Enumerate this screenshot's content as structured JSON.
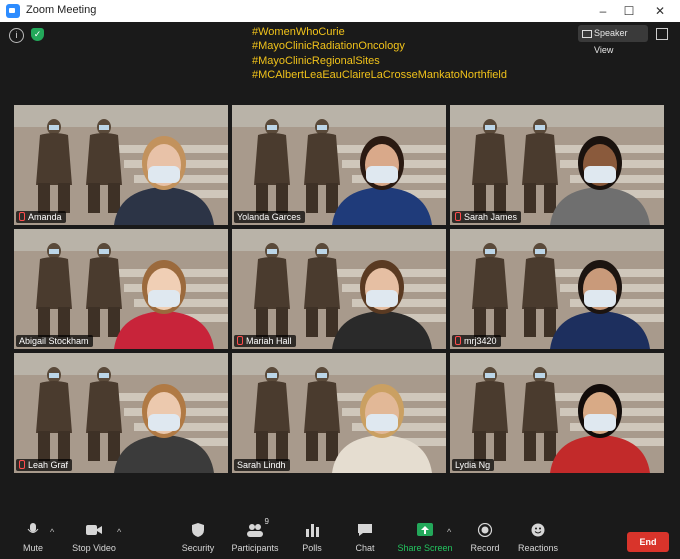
{
  "window": {
    "title": "Zoom Meeting",
    "minimize": "–",
    "maximize": "☐",
    "close": "✕"
  },
  "hashtags": [
    "#WomenWhoCurie",
    "#MayoClinicRadiationOncology",
    "#MayoClinicRegionalSites",
    "#MCAlbertLeaEauClaireLaCrosseMankatoNorthfield"
  ],
  "view_button": "Speaker View",
  "participants": [
    {
      "name": "Amanda",
      "muted": true,
      "active": false
    },
    {
      "name": "Yolanda Garces",
      "muted": false,
      "active": true
    },
    {
      "name": "Sarah James",
      "muted": true,
      "active": false
    },
    {
      "name": "Abigail Stockham",
      "muted": false,
      "active": false
    },
    {
      "name": "Mariah Hall",
      "muted": true,
      "active": false
    },
    {
      "name": "mrj3420",
      "muted": true,
      "active": false
    },
    {
      "name": "Leah Graf",
      "muted": true,
      "active": false
    },
    {
      "name": "Sarah Lindh",
      "muted": false,
      "active": false
    },
    {
      "name": "Lydia Ng",
      "muted": false,
      "active": false
    }
  ],
  "toolbar": {
    "mute": "Mute",
    "stop_video": "Stop Video",
    "security": "Security",
    "participants": "Participants",
    "participants_count": "9",
    "polls": "Polls",
    "chat": "Chat",
    "share_screen": "Share Screen",
    "record": "Record",
    "reactions": "Reactions",
    "end": "End"
  },
  "colors": {
    "hashtag": "#f0c21a",
    "active_border": "#c9e26a",
    "share_green": "#23a85a",
    "end_red": "#d9342b",
    "zoom_blue": "#2d8cff"
  }
}
